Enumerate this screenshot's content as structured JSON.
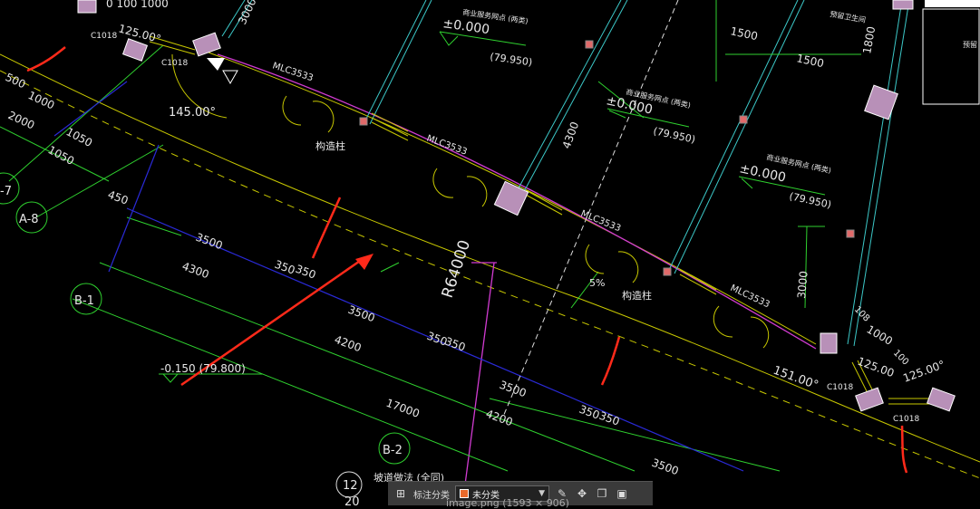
{
  "texts": {
    "t_100_1000": "0 100 1000",
    "t_125_top": "125.00°",
    "t_c1018_a": "C1018",
    "t_c1018_b": "C1018",
    "t_c1018_c": "C1018",
    "t_c1018_d": "C1018",
    "t_3000_top": "3000",
    "t_mlc_1": "MLC3533",
    "t_mlc_2": "MLC3533",
    "t_mlc_3": "MLC3533",
    "t_mlc_4": "MLC3533",
    "t_shop1": "商业服务网点 (两类)",
    "t_shop2": "商业服务网点 (两类)",
    "t_shop3": "商业服务网点 (两类)",
    "t_elev1": "±0.000",
    "t_elev1b": "(79.950)",
    "t_elev2": "±0.000",
    "t_elev2b": "(79.950)",
    "t_elev3": "±0.000",
    "t_elev3b": "(79.950)",
    "t_1500a": "1500",
    "t_1500b": "1500",
    "t_1800": "1800",
    "t_reserve": "预留卫生间",
    "t_reserve2": "预留",
    "t_1000": "1000",
    "t_500": "500",
    "t_2000": "2000",
    "t_1050a": "1050",
    "t_1050b": "1050",
    "t_145": "145.00°",
    "t_gouzao1": "构造柱",
    "t_gouzao2": "构造柱",
    "t_4300_mid": "4300",
    "t_m7": "-7",
    "t_a8": "A-8",
    "t_450": "450",
    "t_3500a": "3500",
    "t_4300a": "4300",
    "t_350a": "350",
    "t_350b": "350",
    "t_b1": "B-1",
    "t_r64000": "R64000",
    "t_5pct": "5%",
    "t_3000_right": "3000",
    "t_3500b": "3500",
    "t_4200a": "4200",
    "t_350c": "350",
    "t_350d": "350",
    "t_neg0150": "-0.150 (79.800)",
    "t_17000": "17000",
    "t_3500c": "3500",
    "t_4200b": "4200",
    "t_350e": "350",
    "t_350f": "350",
    "t_b2": "B-2",
    "t_3500d": "3500",
    "t_151": "151.00°",
    "t_108": "108",
    "t_1000r": "1000",
    "t_100r": "100",
    "t_125r1": "125.00",
    "t_125r2": "125.00°",
    "t_12": "12",
    "t_20": "20",
    "t_ramp": "坡道做法 (全同)"
  },
  "toolbar": {
    "grid_icon": "grid-icon",
    "label": "标注分类",
    "select_value": "未分类",
    "swatch_color": "#e8692b",
    "icons": [
      "edit-icon",
      "move-icon",
      "copy-icon",
      "paste-icon"
    ]
  },
  "image_label": "image.png (1593 × 906)",
  "colors": {
    "background": "#000000",
    "wall_magenta": "#d13bd1",
    "dim_green": "#2fd12f",
    "axis_blue": "#2a2ad8",
    "yellow_line": "#c8c800",
    "cyan_line": "#3cc8c8",
    "annotation_red": "#ff2a1a",
    "text_white": "#e8e8e8"
  }
}
